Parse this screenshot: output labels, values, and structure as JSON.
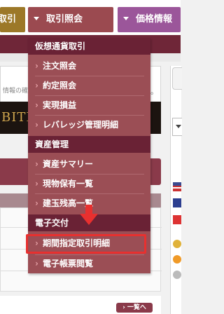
{
  "nav": {
    "tabs": [
      {
        "label": "取引"
      },
      {
        "label": "取引照会"
      },
      {
        "label": "価格情報"
      }
    ]
  },
  "background": {
    "info_text": "情報の確",
    "info_text_end": "。",
    "banner_text": "BITI",
    "more_button": "› 一覧へ"
  },
  "menu": {
    "groups": [
      {
        "heading": "仮想通貨取引",
        "items": [
          {
            "label": "注文照会"
          },
          {
            "label": "約定照会"
          },
          {
            "label": "実現損益"
          },
          {
            "label": "レバレッジ管理明細"
          }
        ]
      },
      {
        "heading": "資産管理",
        "items": [
          {
            "label": "資産サマリー"
          },
          {
            "label": "現物保有一覧"
          },
          {
            "label": "建玉残高一覧"
          }
        ]
      },
      {
        "heading": "電子交付",
        "items": [
          {
            "label": "期間指定取引明細"
          },
          {
            "label": "電子帳票閲覧"
          }
        ]
      }
    ],
    "chevron": "›",
    "highlighted_item": "期間指定取引明細"
  },
  "colors": {
    "menu_bg": "#9b4e55",
    "group_header_bg": "#6a2235",
    "highlight": "#e8302f"
  }
}
